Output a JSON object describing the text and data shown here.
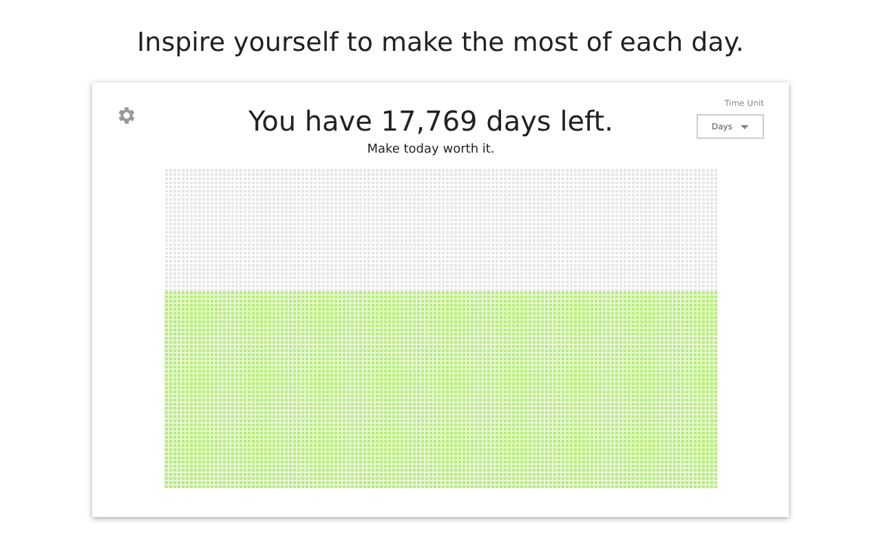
{
  "headline": "Inspire yourself to make the most of each day.",
  "card": {
    "title": "You have 17,769 days left.",
    "subtitle": "Make today worth it.",
    "time_unit": {
      "label": "Time Unit",
      "value": "Days"
    }
  }
}
